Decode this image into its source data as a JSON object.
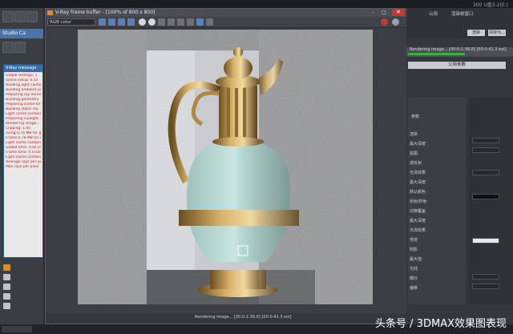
{
  "os_bar": {
    "right_text": "300 U盘3-2(E:)"
  },
  "left_panel": {
    "title": "V-Ray message",
    "buttons": [
      "Studio Ca",
      "隐藏"
    ],
    "log_lines": [
      "Global settings: 1",
      "Scene setup: 0.1s",
      "Building light cache",
      "Building ambient occ",
      "Preparing ray server",
      "Building geometry",
      "Preparing scene for",
      "Building static ray",
      "Light cache contains",
      "Preparing sunlight",
      "Rendering image...",
      "Clipping: 1.0s",
      "Using 0.76 MB for gl",
      "Frame 0.76 MB for re",
      "Light cache contains",
      "Global time: 0.0s (c",
      "Frame time: 0.0 sec",
      "Light cache contain",
      "Average rays per pix",
      "Max rays per pixel"
    ]
  },
  "vfb": {
    "title": "V-Ray frame buffer - [100% of 800 x 800]",
    "channel": "RGB color",
    "min": "–",
    "max": "□",
    "close": "✕"
  },
  "right_panel": {
    "top_tabs": [
      "公用",
      "渲染帧窗口"
    ],
    "btn_a": "渲染",
    "btn_b": "另存为...",
    "progress_label": "Rendering image... [00:0:1:36.8] [00:0:41.3 est]",
    "progress_fraction": 0.55,
    "common_button": "公用参数",
    "section_label": "参数",
    "rows": [
      "渲染",
      "最大深度",
      "贴图",
      "漫反射",
      "光泽效果",
      "最大深度",
      "默认颜色",
      "反射/折射",
      "切换覆盖",
      "最大深度",
      "光泽效果",
      "倍增",
      "阴影",
      "最大值",
      "光线",
      "细分",
      "偏移"
    ]
  },
  "status_bar": {
    "text": "Rendering image... [00:0:1:36.8] [00:0:41.3 est]"
  },
  "watermark": "头条号 / 3DMAX效果图表现",
  "colors": {
    "accent": "#4a74a8",
    "close": "#c43a31",
    "progress": "#3cb043"
  }
}
